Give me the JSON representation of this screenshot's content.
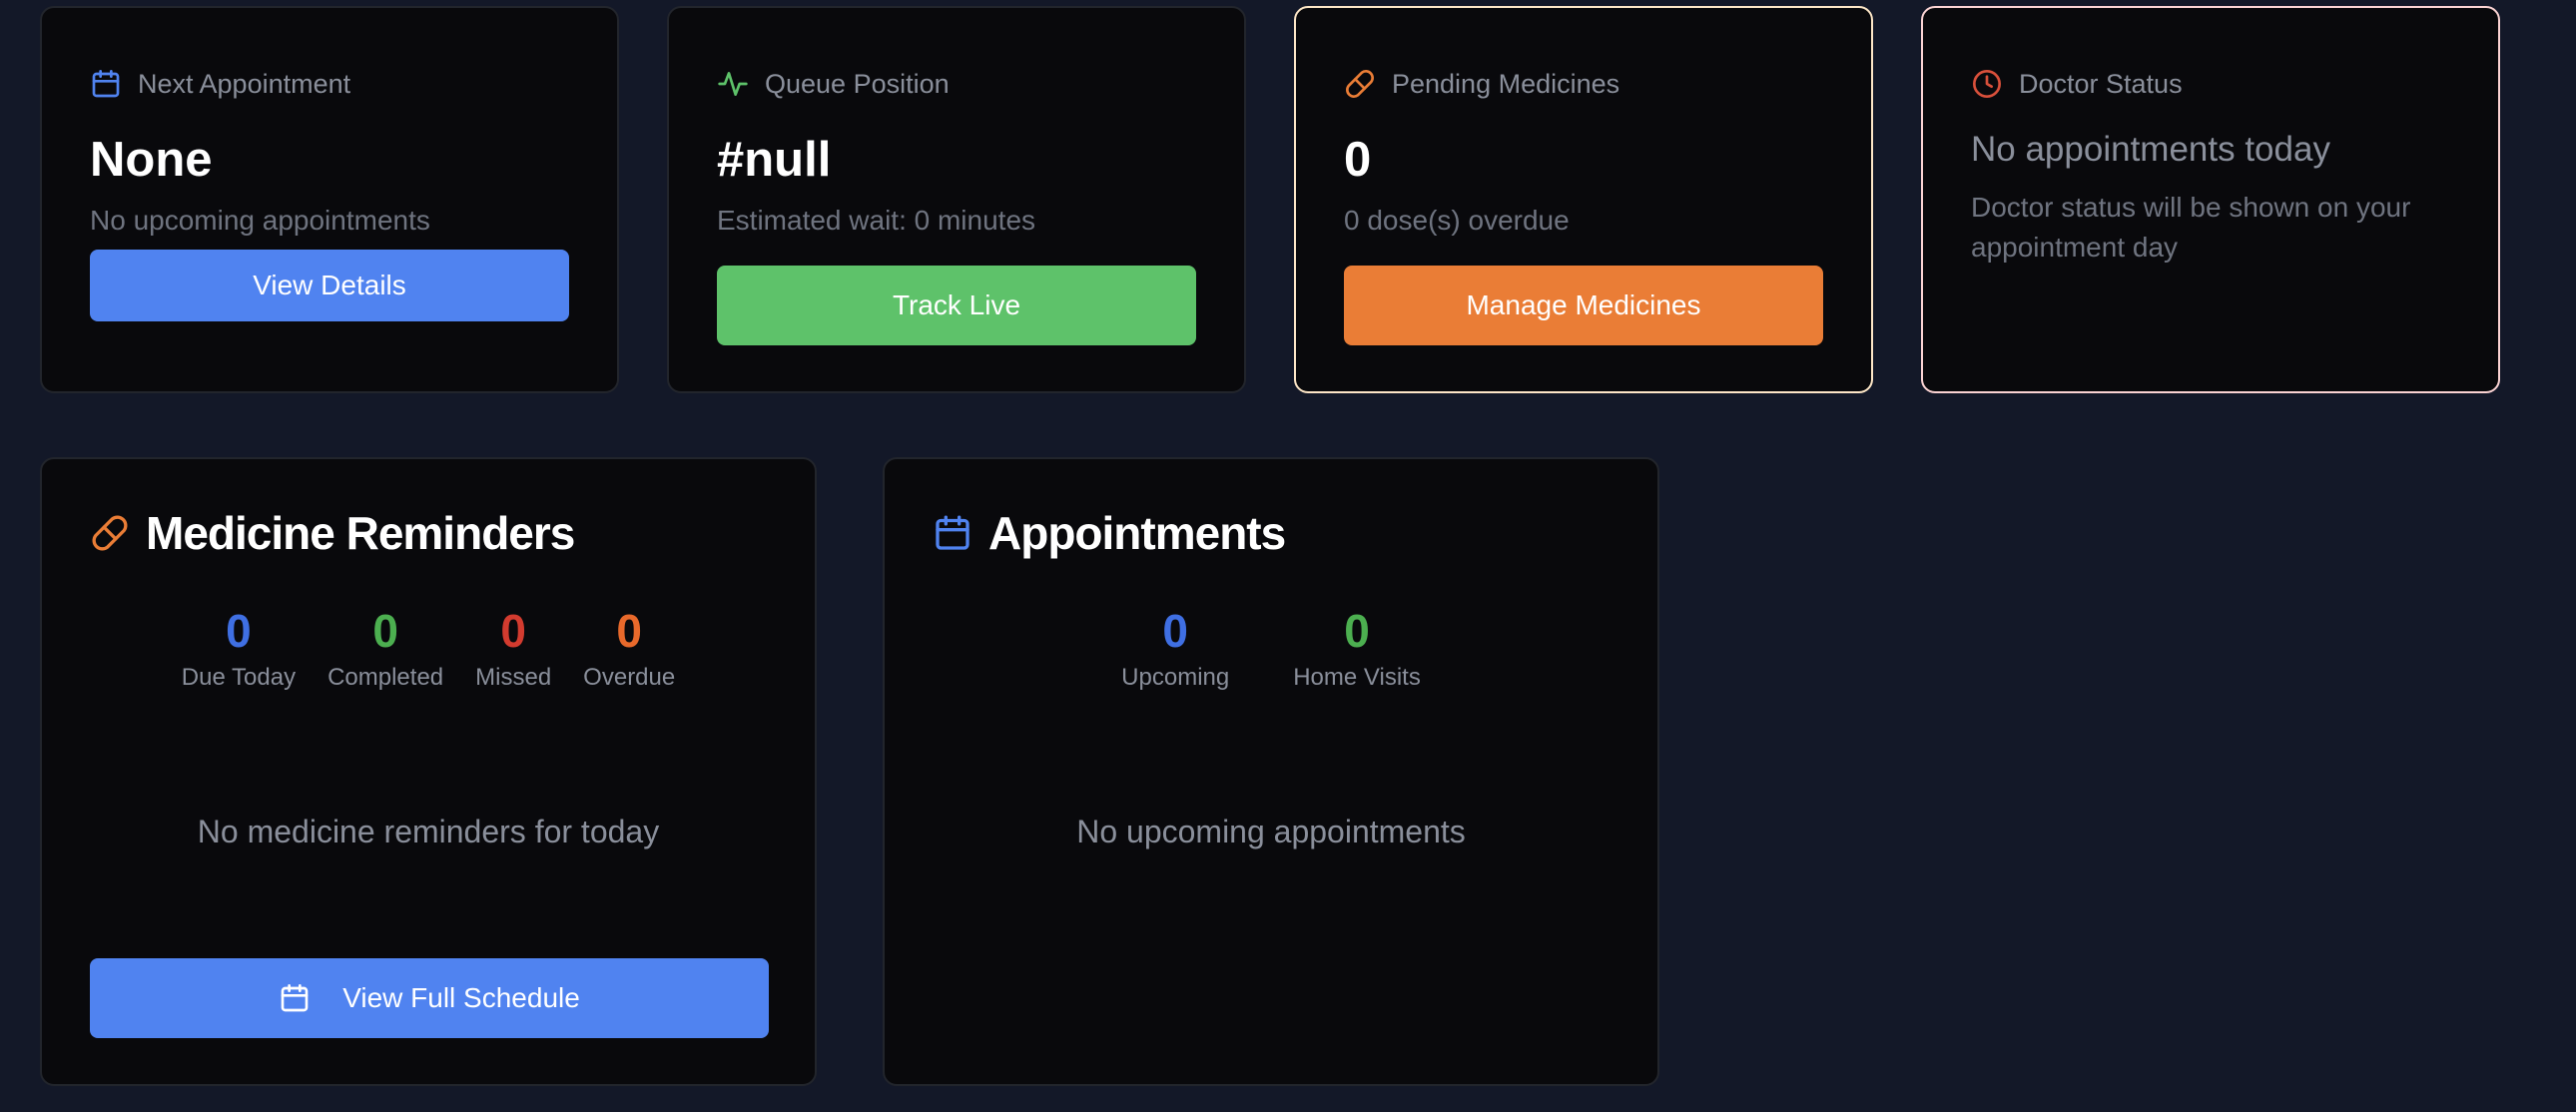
{
  "stat_cards": {
    "next_appointment": {
      "label": "Next Appointment",
      "icon": "calendar-icon",
      "value": "None",
      "sub": "No upcoming appointments",
      "button": "View Details"
    },
    "queue_position": {
      "label": "Queue Position",
      "icon": "activity-icon",
      "value": "#null",
      "sub": "Estimated wait: 0 minutes",
      "button": "Track Live"
    },
    "pending_medicines": {
      "label": "Pending Medicines",
      "icon": "pill-icon",
      "value": "0",
      "sub": "0 dose(s) overdue",
      "button": "Manage Medicines"
    },
    "doctor_status": {
      "label": "Doctor Status",
      "icon": "clock-icon",
      "headline": "No appointments today",
      "desc": "Doctor status will be shown on your appointment day"
    }
  },
  "medicine_reminders": {
    "title": "Medicine Reminders",
    "icon": "pill-icon",
    "metrics": [
      {
        "value": "0",
        "label": "Due Today",
        "color": "#3f6fe3"
      },
      {
        "value": "0",
        "label": "Completed",
        "color": "#4caf50"
      },
      {
        "value": "0",
        "label": "Missed",
        "color": "#d33b2f"
      },
      {
        "value": "0",
        "label": "Overdue",
        "color": "#e8692b"
      }
    ],
    "empty": "No medicine reminders for today",
    "button": "View Full Schedule"
  },
  "appointments": {
    "title": "Appointments",
    "icon": "calendar-icon",
    "metrics": [
      {
        "value": "0",
        "label": "Upcoming",
        "color": "#3f6fe3"
      },
      {
        "value": "0",
        "label": "Home Visits",
        "color": "#4caf50"
      }
    ],
    "empty": "No upcoming appointments"
  },
  "colors": {
    "background": "#131828",
    "card": "#09090c",
    "blue": "#5083f0",
    "green": "#5ec26a",
    "orange": "#ea7d36",
    "red": "#d9503b"
  }
}
